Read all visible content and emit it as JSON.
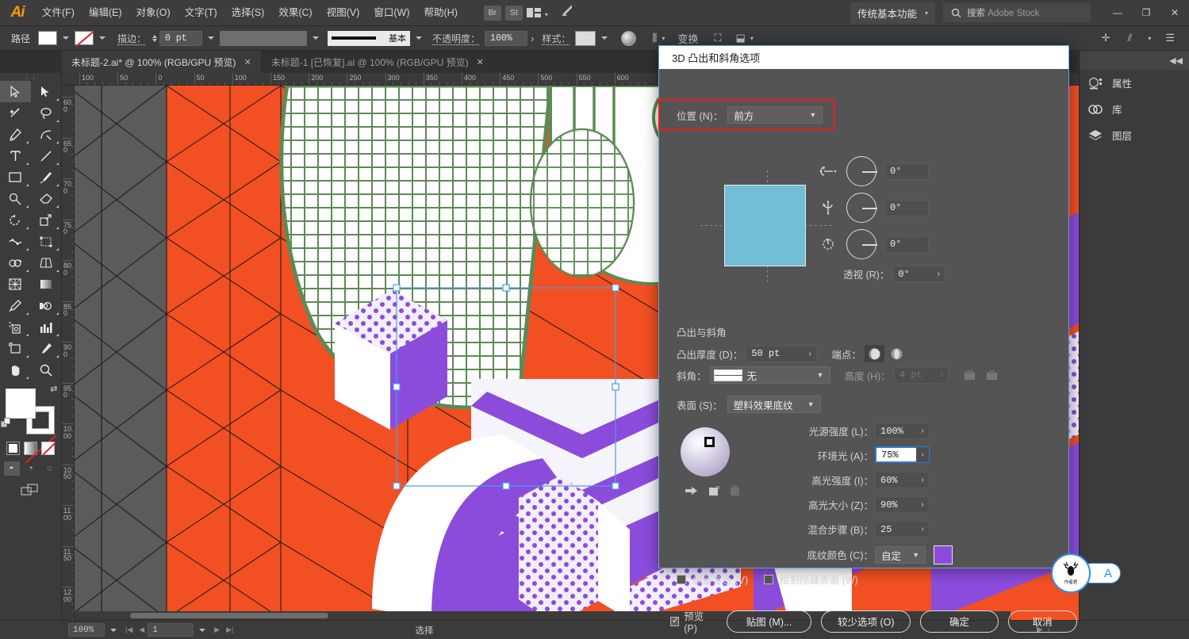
{
  "app": {
    "name": "Ai"
  },
  "menu": {
    "items": [
      "文件(F)",
      "编辑(E)",
      "对象(O)",
      "文字(T)",
      "选择(S)",
      "效果(C)",
      "视图(V)",
      "窗口(W)",
      "帮助(H)"
    ],
    "bridge": "Br",
    "stock": "St",
    "workspace": "传统基本功能",
    "search_placeholder": "搜索 Adobe Stock",
    "search_label": "搜索",
    "search_brand": "Adobe Stock",
    "win_min": "—",
    "win_max": "❐",
    "win_close": "✕"
  },
  "options_bar": {
    "object_label": "路径",
    "stroke_label": "描边：",
    "stroke_weight": "0 pt",
    "brush_name": "基本",
    "opacity_label": "不透明度：",
    "opacity_value": "100%",
    "style_label": "样式：",
    "transform_label": "变换"
  },
  "tabs": [
    {
      "title": "未标题-2.ai* @ 100% (RGB/GPU 预览)",
      "active": true,
      "close": "✕"
    },
    {
      "title": "未标题-1 [已恢复].ai @ 100% (RGB/GPU 预览)",
      "active": false,
      "close": "✕"
    }
  ],
  "rulers": {
    "h_labels": [
      "100",
      "50",
      "0",
      "50",
      "100",
      "150",
      "200",
      "250",
      "300",
      "350",
      "400",
      "450",
      "500",
      "550",
      "600"
    ],
    "v_labels": [
      "600",
      "650",
      "700",
      "750",
      "800",
      "850",
      "900",
      "950",
      "1000",
      "1050",
      "1100",
      "1150",
      "1200"
    ]
  },
  "right_panel": {
    "collapse": "◀◀",
    "items": [
      {
        "label": "属性",
        "icon": "properties-icon"
      },
      {
        "label": "库",
        "icon": "library-icon"
      },
      {
        "label": "图层",
        "icon": "layers-icon"
      }
    ]
  },
  "status_bar": {
    "zoom": "100%",
    "page": "1",
    "tool_status": "选择"
  },
  "dialog": {
    "title": "3D 凸出和斜角选项",
    "position_label": "位置 (N)：",
    "position_value": "前方",
    "rotate": [
      {
        "axis": "x-rotate-icon",
        "value": "0°"
      },
      {
        "axis": "y-rotate-icon",
        "value": "0°"
      },
      {
        "axis": "z-rotate-icon",
        "value": "0°"
      }
    ],
    "perspective_label": "透视 (R)：",
    "perspective_value": "0°",
    "extrude_section": "凸出与斜角",
    "extrude_depth_label": "凸出厚度 (D)：",
    "extrude_depth_value": "50 pt",
    "cap_label": "端点：",
    "bevel_label": "斜角：",
    "bevel_value": "无",
    "height_label": "高度 (H)：",
    "height_value": "4 pt",
    "surface_label": "表面 (S)：",
    "surface_value": "塑料效果底纹",
    "lighting": [
      {
        "label": "光源强度 (L)：",
        "value": "100%",
        "focused": false
      },
      {
        "label": "环境光 (A)：",
        "value": "75%",
        "focused": true
      },
      {
        "label": "高光强度 (I)：",
        "value": "60%",
        "focused": false
      },
      {
        "label": "高光大小 (Z)：",
        "value": "90%",
        "focused": false
      },
      {
        "label": "混合步骤 (B)：",
        "value": "25",
        "focused": false
      }
    ],
    "shade_color_label": "底纹颜色 (C)：",
    "shade_color_value": "自定",
    "shade_color_hex": "#8b4cdc",
    "checkbox_spot": "保留专色 (V)",
    "checkbox_hidden": "绘制隐藏表面 (W)",
    "preview_label": "预览 (P)",
    "buttons": {
      "map": "贴图 (M)...",
      "fewer": "较少选项 (O)",
      "ok": "确定",
      "cancel": "取消"
    },
    "highlight_color": "#e81c1c",
    "accent_color": "#2a7fd4"
  },
  "canvas": {
    "artboard_bg": "#f25022",
    "accent_purple": "#8b4cdc",
    "accent_green": "#5d8a55",
    "canvas_bg": "#5b5b5b"
  },
  "watermark": {
    "glyph": "🦌",
    "sub": "作者君",
    "letter": "A"
  }
}
